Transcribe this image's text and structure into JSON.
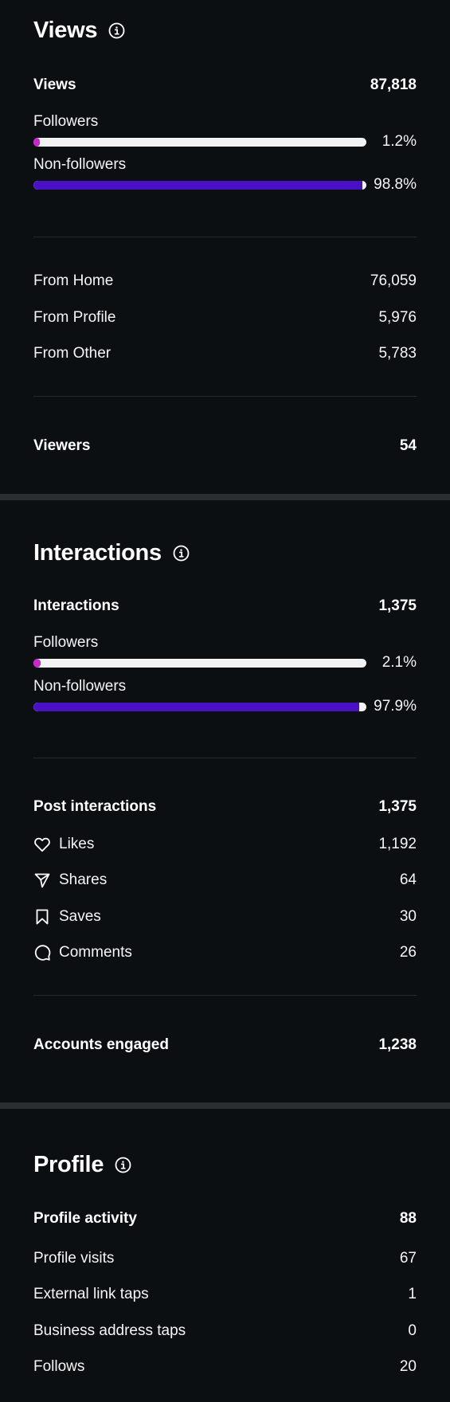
{
  "colors": {
    "background": "#0c0f12",
    "followers_bar": "#c728c9",
    "non_followers_bar": "#4a10c4",
    "track": "#f2f2f2"
  },
  "views": {
    "title": "Views",
    "info_icon": "info-circle-icon",
    "total_label": "Views",
    "total_value": "87,818",
    "followers_label": "Followers",
    "followers_pct": "1.2%",
    "followers_fraction": 0.012,
    "non_followers_label": "Non-followers",
    "non_followers_pct": "98.8%",
    "non_followers_fraction": 0.988,
    "sources": [
      {
        "label": "From Home",
        "value": "76,059"
      },
      {
        "label": "From Profile",
        "value": "5,976"
      },
      {
        "label": "From Other",
        "value": "5,783"
      }
    ],
    "viewers_label": "Viewers",
    "viewers_value": "54"
  },
  "interactions": {
    "title": "Interactions",
    "info_icon": "info-circle-icon",
    "total_label": "Interactions",
    "total_value": "1,375",
    "followers_label": "Followers",
    "followers_pct": "2.1%",
    "followers_fraction": 0.021,
    "non_followers_label": "Non-followers",
    "non_followers_pct": "97.9%",
    "non_followers_fraction": 0.979,
    "post_label": "Post interactions",
    "post_value": "1,375",
    "items": [
      {
        "icon": "heart-icon",
        "label": "Likes",
        "value": "1,192"
      },
      {
        "icon": "send-icon",
        "label": "Shares",
        "value": "64"
      },
      {
        "icon": "bookmark-icon",
        "label": "Saves",
        "value": "30"
      },
      {
        "icon": "comment-icon",
        "label": "Comments",
        "value": "26"
      }
    ],
    "accounts_label": "Accounts engaged",
    "accounts_value": "1,238"
  },
  "profile": {
    "title": "Profile",
    "info_icon": "info-circle-icon",
    "activity_label": "Profile activity",
    "activity_value": "88",
    "rows": [
      {
        "label": "Profile visits",
        "value": "67"
      },
      {
        "label": "External link taps",
        "value": "1"
      },
      {
        "label": "Business address taps",
        "value": "0"
      },
      {
        "label": "Follows",
        "value": "20"
      }
    ]
  }
}
